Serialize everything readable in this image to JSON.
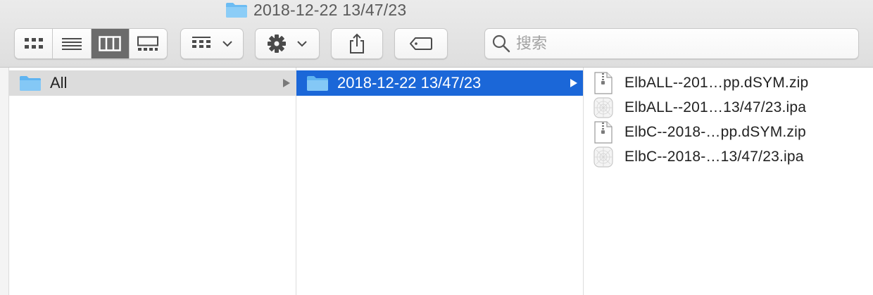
{
  "window": {
    "title": "2018-12-22 13/47/23",
    "title_icon": "folder-icon"
  },
  "toolbar": {
    "view_modes": [
      {
        "name": "icon-view",
        "icon": "grid-icon",
        "active": false
      },
      {
        "name": "list-view",
        "icon": "list-icon",
        "active": false
      },
      {
        "name": "column-view",
        "icon": "columns-icon",
        "active": true
      },
      {
        "name": "gallery-view",
        "icon": "gallery-icon",
        "active": false
      }
    ],
    "group_icon": "group-grid-icon",
    "action_icon": "gear-icon",
    "share_icon": "share-icon",
    "tag_icon": "tag-icon",
    "search_placeholder": "搜索"
  },
  "columns": {
    "col1": {
      "items": [
        {
          "label": "All",
          "icon": "folder-icon",
          "selected": "gray",
          "has_children": true
        }
      ]
    },
    "col2": {
      "items": [
        {
          "label": "2018-12-22 13/47/23",
          "icon": "folder-icon",
          "selected": "blue",
          "has_children": true
        }
      ]
    },
    "col3": {
      "items": [
        {
          "label": "ElbALL--201…pp.dSYM.zip",
          "icon": "zip-file-icon"
        },
        {
          "label": "ElbALL--201…13/47/23.ipa",
          "icon": "ipa-file-icon"
        },
        {
          "label": "ElbC--2018-…pp.dSYM.zip",
          "icon": "zip-file-icon"
        },
        {
          "label": "ElbC--2018-…13/47/23.ipa",
          "icon": "ipa-file-icon"
        }
      ]
    }
  },
  "colors": {
    "selection_blue": "#1b67d8",
    "selection_gray": "#dcdcdc",
    "folder_blue": "#5fb4f1"
  }
}
